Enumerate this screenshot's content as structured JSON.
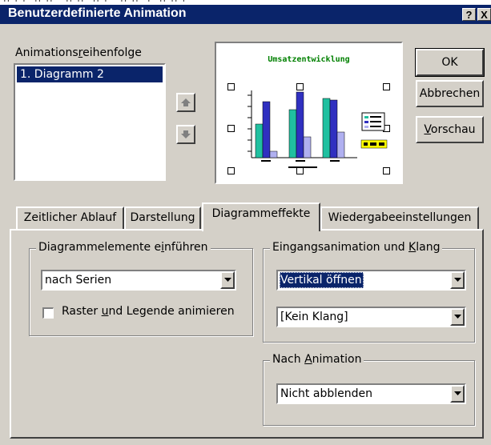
{
  "dialog": {
    "title": "Benutzerdefinierte Animation",
    "title_buttons": [
      "?",
      "X"
    ]
  },
  "order": {
    "label_pre": "Animations",
    "label_u": "r",
    "label_post": "eihenfolge",
    "items": [
      "1. Diagramm 2"
    ],
    "move_up_icon": "arrow-up-icon",
    "move_down_icon": "arrow-down-icon"
  },
  "preview": {
    "chart_title": "Umsatzentwicklung"
  },
  "buttons": {
    "ok": "OK",
    "cancel": "Abbrechen",
    "preview_pre": "",
    "preview_u": "V",
    "preview_post": "orschau"
  },
  "tabs": [
    {
      "label": "Zeitlicher Ablauf",
      "active": false
    },
    {
      "label": "Darstellung",
      "active": false
    },
    {
      "label": "Diagrammeffekte",
      "active": true
    },
    {
      "label": "Wiedergabeeinstellungen",
      "active": false
    }
  ],
  "introduce_group": {
    "legend_pre": "Diagrammelemente e",
    "legend_u": "i",
    "legend_post": "nführen",
    "select_value": "nach Serien",
    "checkbox_pre": "Raster ",
    "checkbox_u": "u",
    "checkbox_post": "nd Legende animieren",
    "checkbox_checked": false
  },
  "entry_group": {
    "legend_pre": "Eingangsanimation und ",
    "legend_u": "K",
    "legend_post": "lang",
    "effect_value": "Vertikal öffnen",
    "sound_value": "[Kein Klang]"
  },
  "after_group": {
    "legend_pre": "Nach ",
    "legend_u": "A",
    "legend_post": "nimation",
    "select_value": "Nicht abblenden"
  },
  "colors": {
    "title_bar": "#0a246a",
    "dialog_bg": "#d4d0c8",
    "chart_title": "#008000",
    "bar_teal": "#20c0a0",
    "bar_blue": "#3030c0",
    "bar_lavender": "#b0b0f0",
    "legend_box": "#ffff00"
  }
}
